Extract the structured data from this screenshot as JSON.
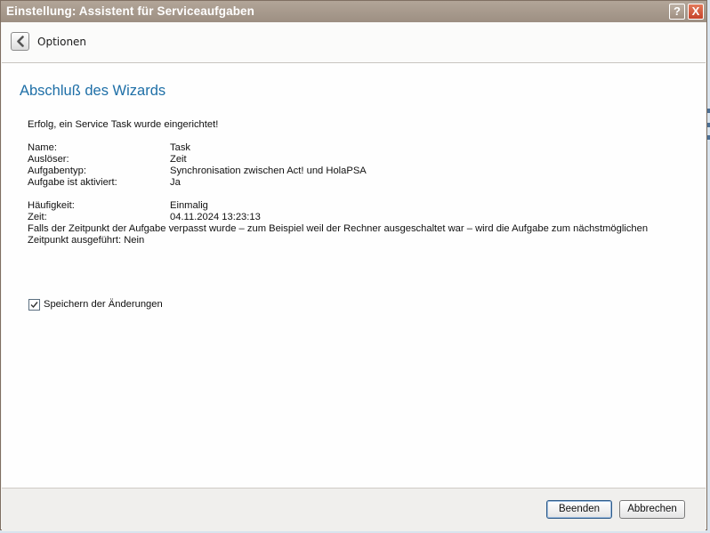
{
  "window": {
    "title": "Einstellung: Assistent für Serviceaufgaben",
    "help_label": "?",
    "close_label": "X"
  },
  "header": {
    "back_icon": "chevron-left-icon",
    "label": "Optionen"
  },
  "page": {
    "title": "Abschluß des Wizards",
    "success_message": "Erfolg, ein Service Task wurde eingerichtet!"
  },
  "details": [
    {
      "label": "Name:",
      "value": "Task"
    },
    {
      "label": "Auslöser:",
      "value": "Zeit"
    },
    {
      "label": "Aufgabentyp:",
      "value": "Synchronisation zwischen Act! und HolaPSA"
    },
    {
      "label": "Aufgabe ist aktiviert:",
      "value": "Ja"
    }
  ],
  "schedule": [
    {
      "label": "Häufigkeit:",
      "value": "Einmalig"
    },
    {
      "label": "Zeit:",
      "value": "04.11.2024 13:23:13"
    }
  ],
  "missed_note": {
    "line1": "Falls der Zeitpunkt der Aufgabe verpasst wurde – zum Beispiel weil der Rechner ausgeschaltet war – wird die Aufgabe zum nächstmöglichen",
    "line2": "Zeitpunkt ausgeführt: Nein"
  },
  "save_changes": {
    "label": "Speichern der Änderungen",
    "checked": true
  },
  "footer": {
    "finish_label": "Beenden",
    "cancel_label": "Abbrechen"
  },
  "colors": {
    "title_bar": "#a89a8d",
    "page_title": "#1e6fa7",
    "close_button": "#d2553a"
  }
}
